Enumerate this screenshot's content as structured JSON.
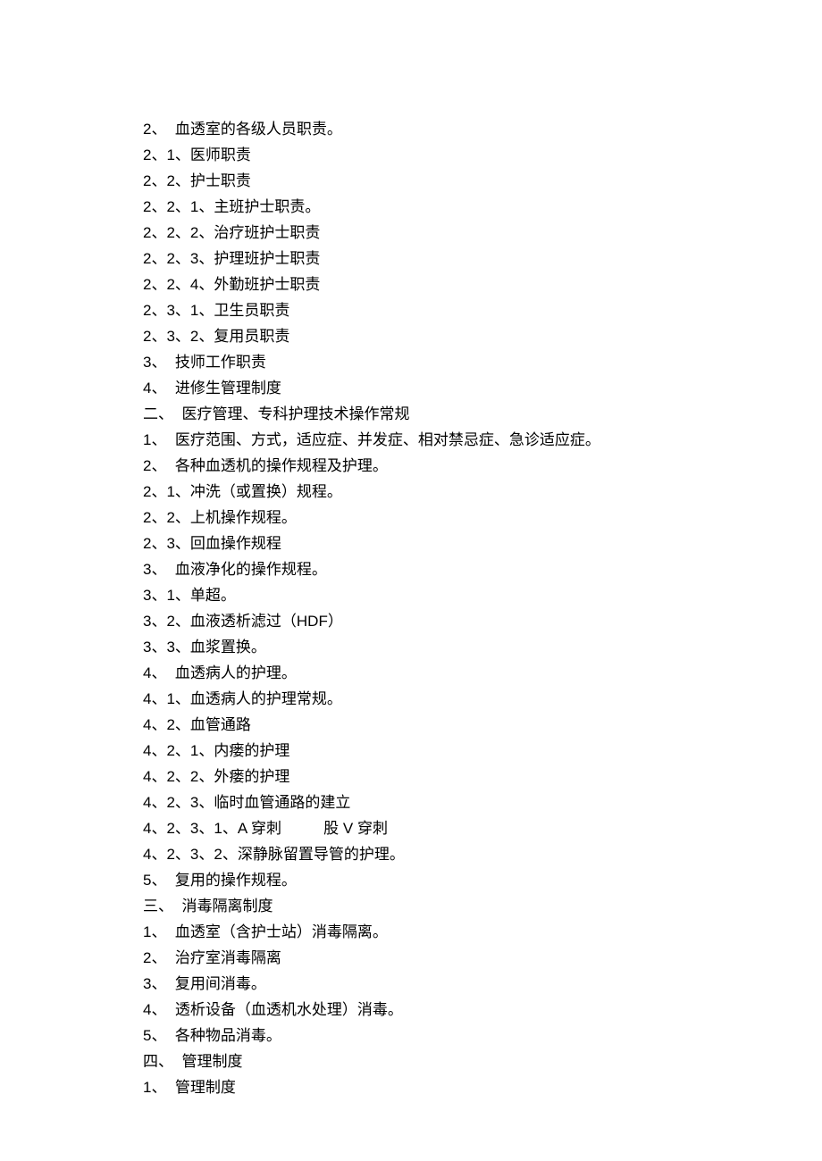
{
  "lines": [
    "2、  血透室的各级人员职责。",
    "2、1、医师职责",
    "2、2、护士职责",
    "2、2、1、主班护士职责。",
    "2、2、2、治疗班护士职责",
    "2、2、3、护理班护士职责",
    "2、2、4、外勤班护士职责",
    "2、3、1、卫生员职责",
    "2、3、2、复用员职责",
    "3、  技师工作职责",
    "4、  进修生管理制度",
    "二、  医疗管理、专科护理技术操作常规",
    "1、  医疗范围、方式，适应症、并发症、相对禁忌症、急诊适应症。",
    "2、  各种血透机的操作规程及护理。",
    "2、1、冲洗（或置换）规程。",
    "2、2、上机操作规程。",
    "2、3、回血操作规程",
    "3、  血液净化的操作规程。",
    "3、1、单超。",
    "3、2、血液透析滤过（HDF）",
    "3、3、血浆置换。",
    "4、  血透病人的护理。",
    "4、1、血透病人的护理常规。",
    "4、2、血管通路",
    "4、2、1、内瘘的护理",
    "4、2、2、外瘘的护理",
    "4、2、3、临时血管通路的建立",
    "4、2、3、1、A 穿刺          股 V 穿刺",
    "4、2、3、2、深静脉留置导管的护理。",
    "5、  复用的操作规程。",
    "三、  消毒隔离制度",
    "1、  血透室（含护士站）消毒隔离。",
    "2、  治疗室消毒隔离",
    "3、  复用间消毒。",
    "4、  透析设备（血透机水处理）消毒。",
    "5、  各种物品消毒。",
    "四、  管理制度",
    "1、  管理制度"
  ]
}
